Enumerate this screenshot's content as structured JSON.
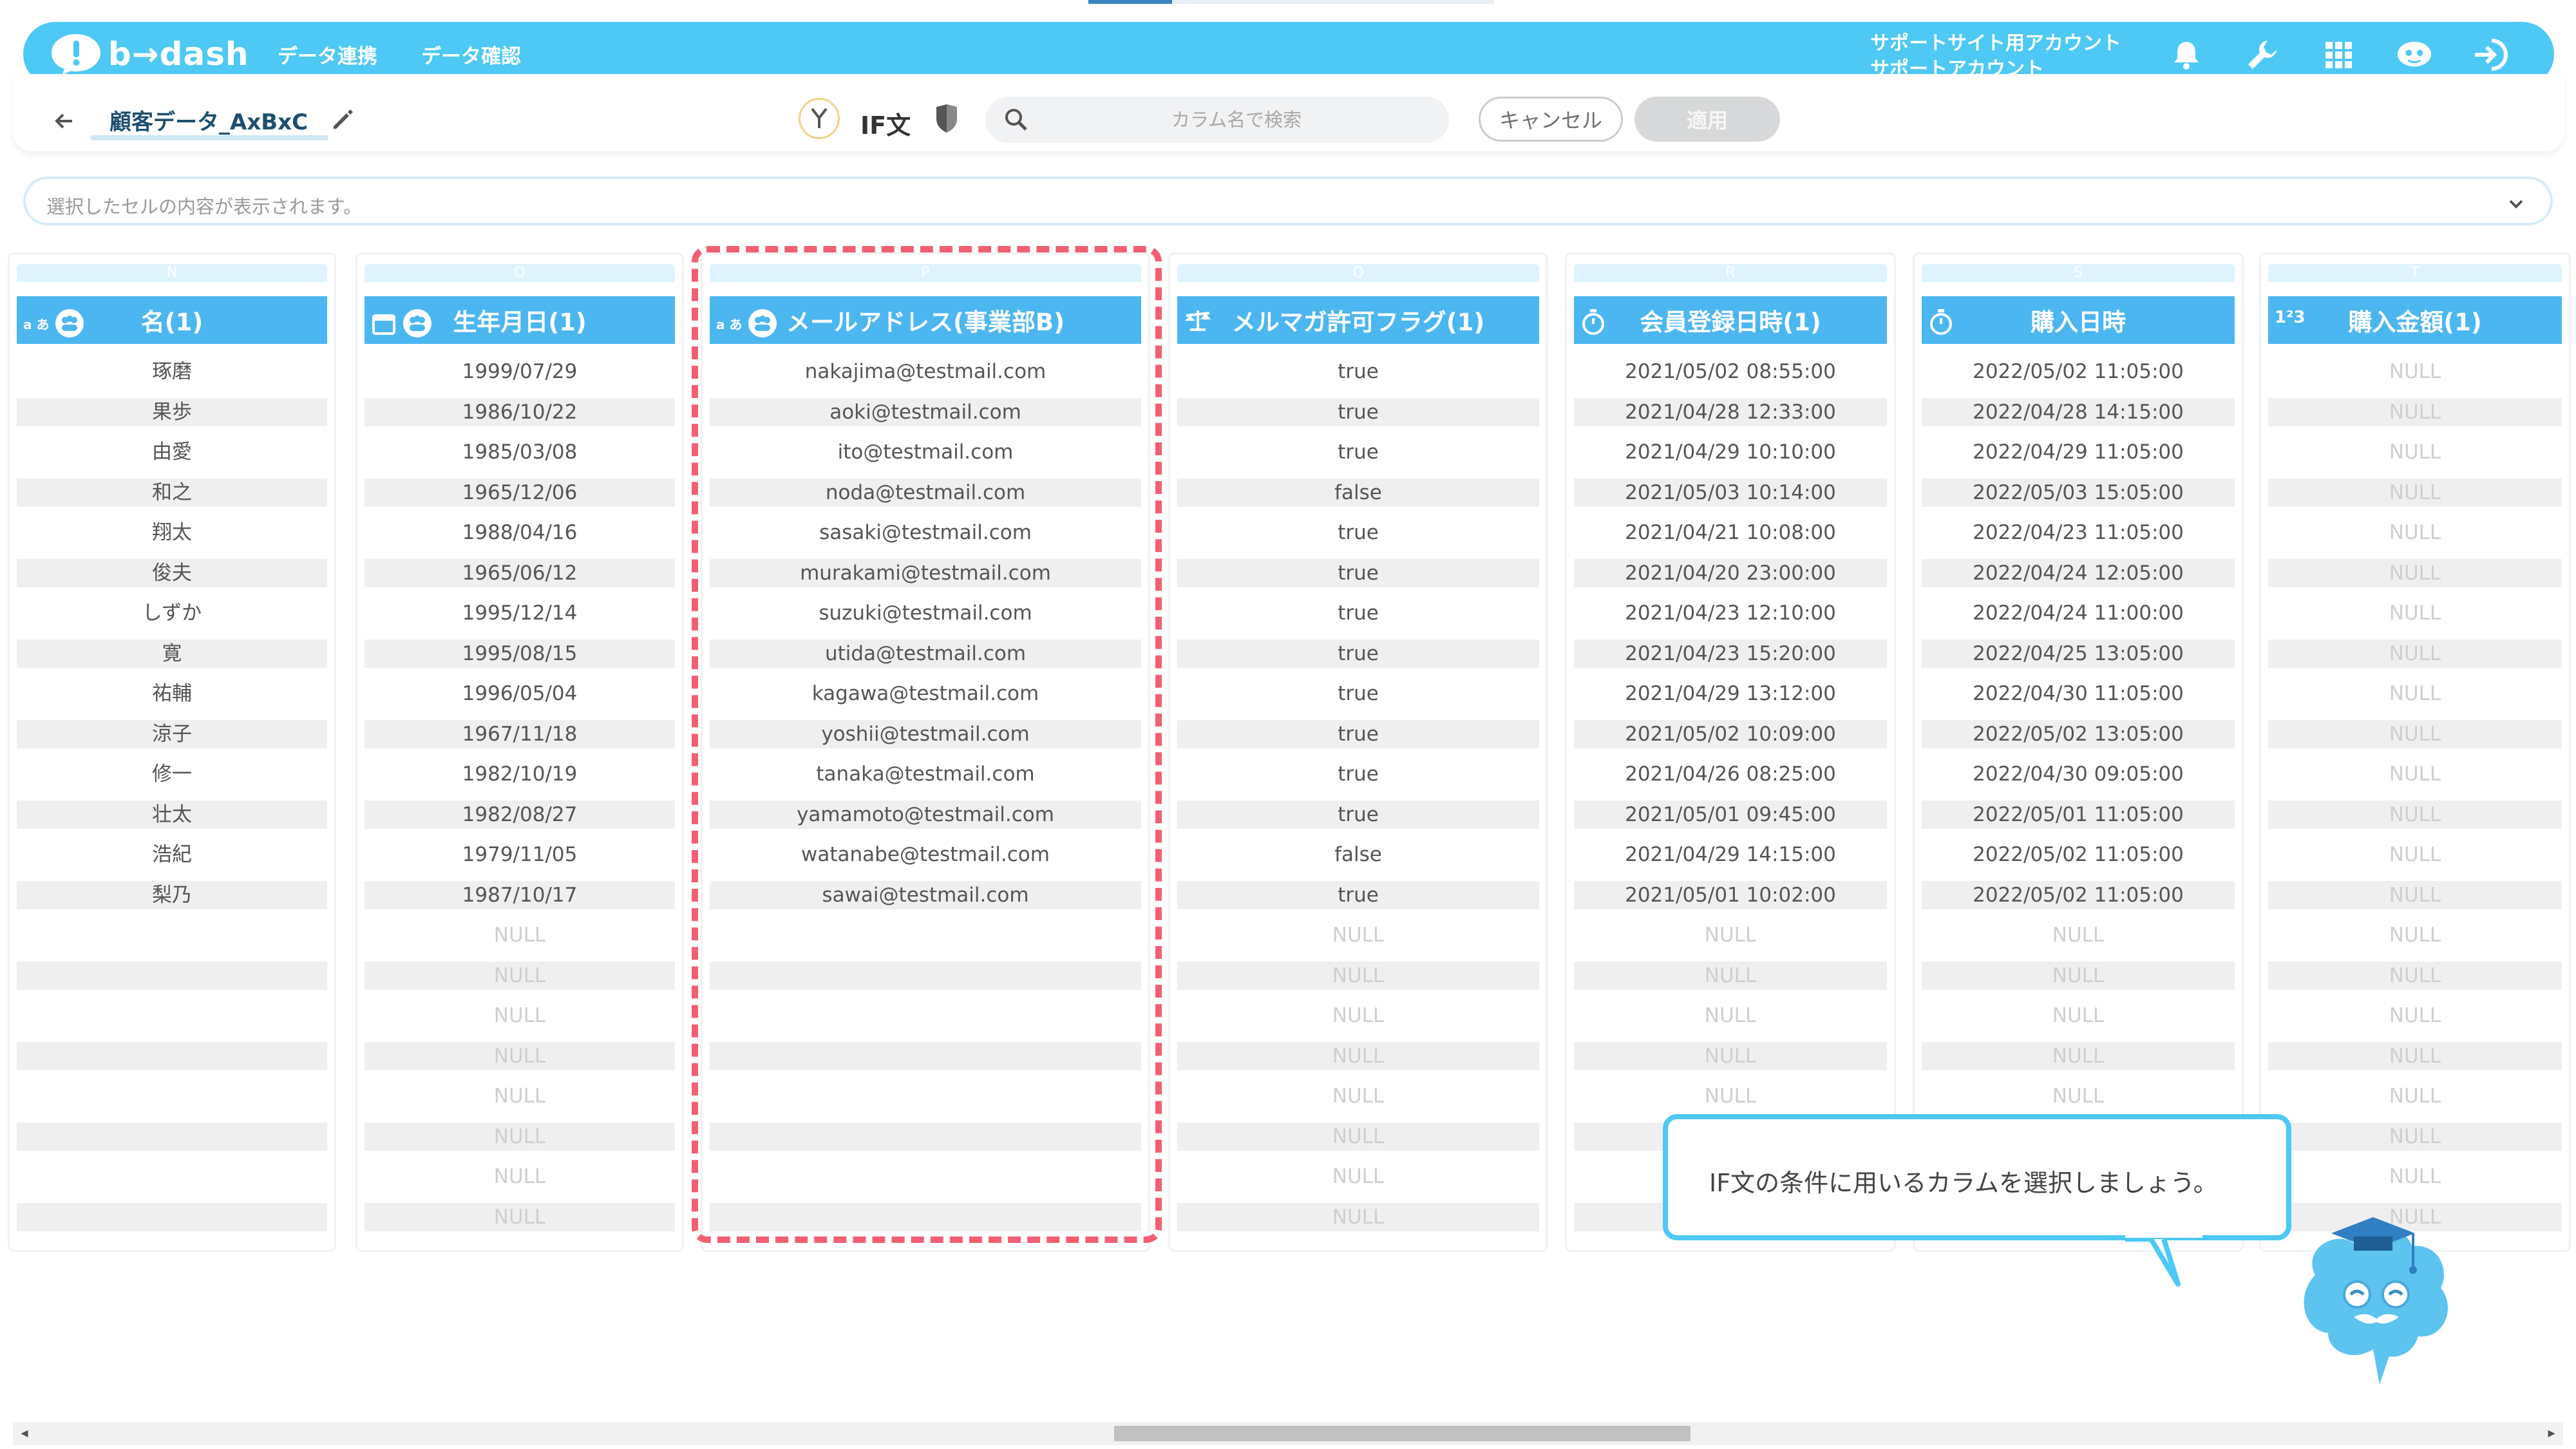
{
  "app": {
    "brand": "b→dash",
    "nav": [
      "データ連携",
      "データ確認"
    ],
    "account_line1": "サポートサイト用アカウント",
    "account_line2": "サポートアカウント",
    "header_icons": [
      "bell-icon",
      "wrench-icon",
      "grid-icon",
      "mascot-face-icon",
      "logout-icon"
    ],
    "accent": "#4ec8f4"
  },
  "toolbar": {
    "table_name": "顧客データ_AxBxC",
    "if_label": "IF文",
    "search_placeholder": "カラム名で検索",
    "cancel_label": "キャンセル",
    "apply_label": "適用"
  },
  "preview": {
    "placeholder": "選択したセルの内容が表示されます。"
  },
  "columns": [
    {
      "letter": "N",
      "type": "text",
      "name": "名(1)",
      "cells": [
        "琢磨",
        "果歩",
        "由愛",
        "和之",
        "翔太",
        "俊夫",
        "しずか",
        "寛",
        "祐輔",
        "涼子",
        "修一",
        "壮太",
        "浩紀",
        "梨乃",
        "",
        "",
        "",
        "",
        "",
        "",
        "",
        ""
      ]
    },
    {
      "letter": "O",
      "type": "date",
      "name": "生年月日(1)",
      "cells": [
        "1999/07/29",
        "1986/10/22",
        "1985/03/08",
        "1965/12/06",
        "1988/04/16",
        "1965/06/12",
        "1995/12/14",
        "1995/08/15",
        "1996/05/04",
        "1967/11/18",
        "1982/10/19",
        "1982/08/27",
        "1979/11/05",
        "1987/10/17",
        "NULL",
        "NULL",
        "NULL",
        "NULL",
        "NULL",
        "NULL",
        "NULL",
        "NULL"
      ]
    },
    {
      "letter": "P",
      "type": "text",
      "name": "メールアドレス(事業部B)",
      "cells": [
        "nakajima@testmail.com",
        "aoki@testmail.com",
        "ito@testmail.com",
        "noda@testmail.com",
        "sasaki@testmail.com",
        "murakami@testmail.com",
        "suzuki@testmail.com",
        "utida@testmail.com",
        "kagawa@testmail.com",
        "yoshii@testmail.com",
        "tanaka@testmail.com",
        "yamamoto@testmail.com",
        "watanabe@testmail.com",
        "sawai@testmail.com",
        "",
        "",
        "",
        "",
        "",
        "",
        "",
        ""
      ]
    },
    {
      "letter": "Q",
      "type": "boolean",
      "name": "メルマガ許可フラグ(1)",
      "cells": [
        "true",
        "true",
        "true",
        "false",
        "true",
        "true",
        "true",
        "true",
        "true",
        "true",
        "true",
        "true",
        "false",
        "true",
        "NULL",
        "NULL",
        "NULL",
        "NULL",
        "NULL",
        "NULL",
        "NULL",
        "NULL"
      ]
    },
    {
      "letter": "R",
      "type": "datetime",
      "name": "会員登録日時(1)",
      "cells": [
        "2021/05/02 08:55:00",
        "2021/04/28 12:33:00",
        "2021/04/29 10:10:00",
        "2021/05/03 10:14:00",
        "2021/04/21 10:08:00",
        "2021/04/20 23:00:00",
        "2021/04/23 12:10:00",
        "2021/04/23 15:20:00",
        "2021/04/29 13:12:00",
        "2021/05/02 10:09:00",
        "2021/04/26 08:25:00",
        "2021/05/01 09:45:00",
        "2021/04/29 14:15:00",
        "2021/05/01 10:02:00",
        "NULL",
        "NULL",
        "NULL",
        "NULL",
        "NULL",
        "NULL",
        "NULL",
        "NULL"
      ]
    },
    {
      "letter": "S",
      "type": "datetime",
      "name": "購入日時",
      "cells": [
        "2022/05/02 11:05:00",
        "2022/04/28 14:15:00",
        "2022/04/29 11:05:00",
        "2022/05/03 15:05:00",
        "2022/04/23 11:05:00",
        "2022/04/24 12:05:00",
        "2022/04/24 11:00:00",
        "2022/04/25 13:05:00",
        "2022/04/30 11:05:00",
        "2022/05/02 13:05:00",
        "2022/04/30 09:05:00",
        "2022/05/01 11:05:00",
        "2022/05/02 11:05:00",
        "2022/05/02 11:05:00",
        "NULL",
        "NULL",
        "NULL",
        "NULL",
        "NULL",
        "NULL",
        "NULL",
        "NULL"
      ]
    },
    {
      "letter": "T",
      "type": "number",
      "name": "購入金額(1)",
      "cells": [
        "NULL",
        "NULL",
        "NULL",
        "NULL",
        "NULL",
        "NULL",
        "NULL",
        "NULL",
        "NULL",
        "NULL",
        "NULL",
        "NULL",
        "NULL",
        "NULL",
        "NULL",
        "NULL",
        "NULL",
        "NULL",
        "NULL",
        "NULL",
        "NULL",
        "NULL"
      ]
    }
  ],
  "tooltip": {
    "text": "IF文の条件に用いるカラムを選択しましょう。"
  }
}
